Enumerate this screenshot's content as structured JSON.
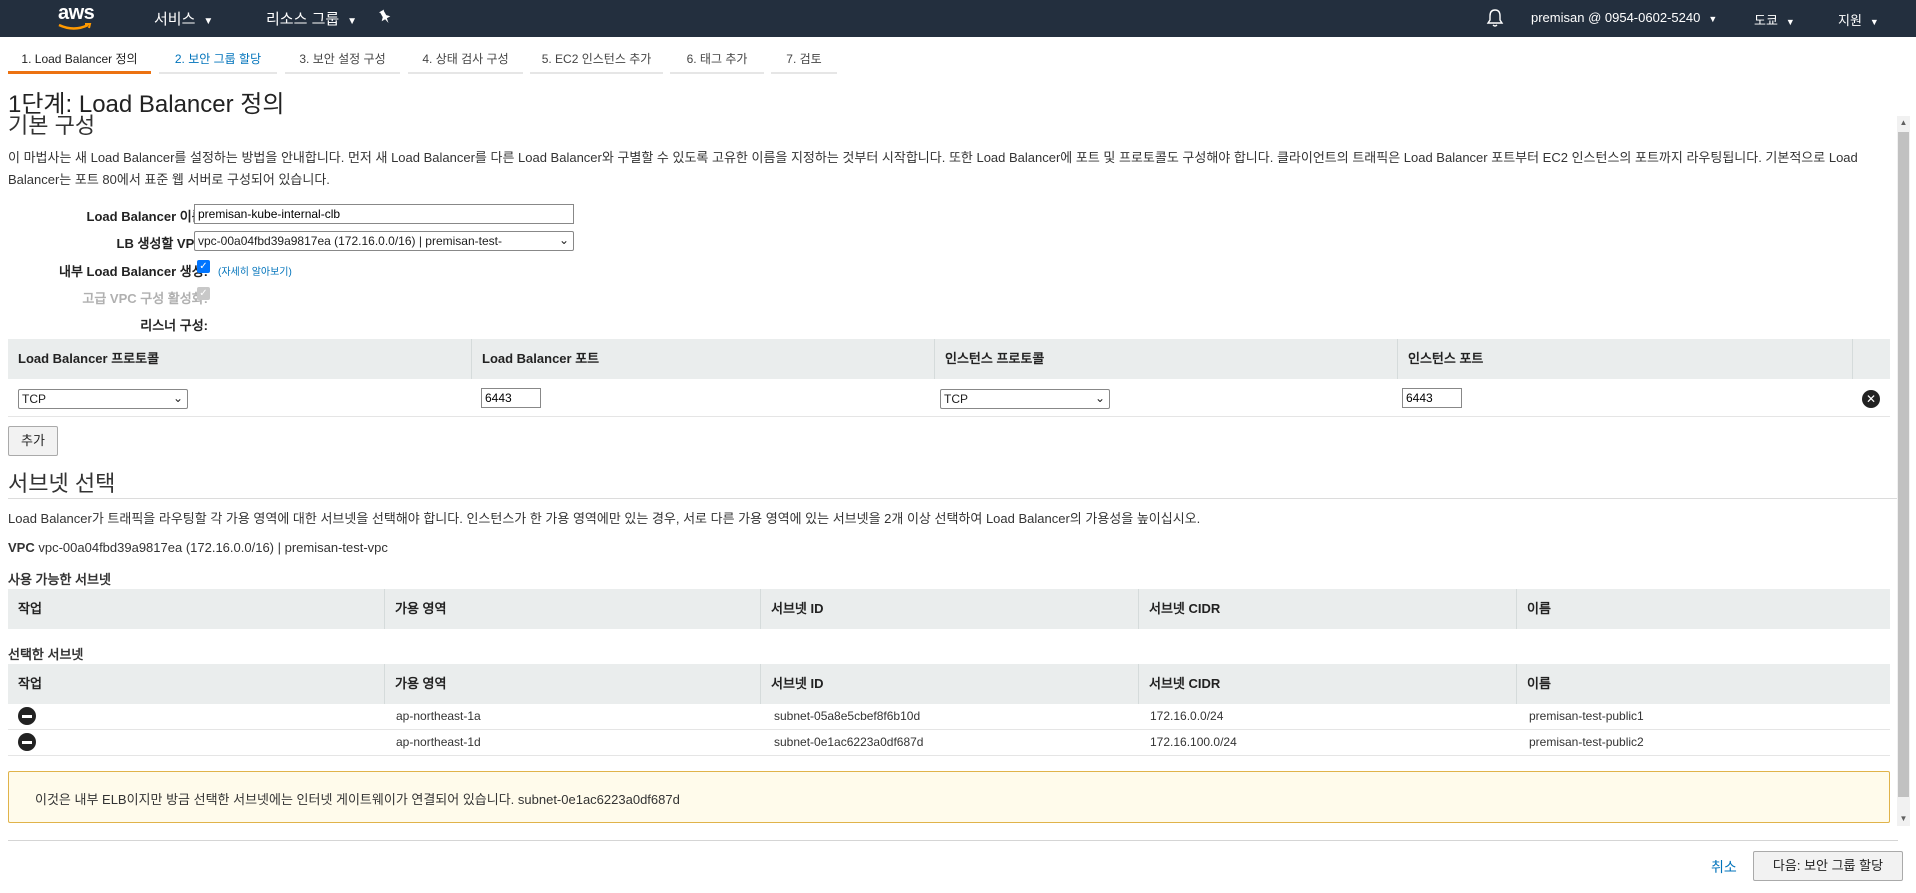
{
  "topnav": {
    "logo": "aws",
    "services": "서비스",
    "resource_groups": "리소스 그룹",
    "account": "premisan @ 0954-0602-5240",
    "region": "도쿄",
    "support": "지원",
    "colors": {
      "bg": "#232f3e",
      "accent": "#ec7211"
    }
  },
  "tabs": [
    {
      "label": "1. Load Balancer 정의"
    },
    {
      "label": "2. 보안 그룹 할당"
    },
    {
      "label": "3. 보안 설정 구성"
    },
    {
      "label": "4. 상태 검사 구성"
    },
    {
      "label": "5. EC2 인스턴스 추가"
    },
    {
      "label": "6. 태그 추가"
    },
    {
      "label": "7. 검토"
    }
  ],
  "page": {
    "title": "1단계: Load Balancer 정의",
    "subtitle": "기본 구성",
    "description": "이 마법사는 새 Load Balancer를 설정하는 방법을 안내합니다. 먼저 새 Load Balancer를 다른 Load Balancer와 구별할 수 있도록 고유한 이름을 지정하는 것부터 시작합니다. 또한 Load Balancer에 포트 및 프로토콜도 구성해야 합니다. 클라이언트의 트래픽은 Load Balancer 포트부터 EC2 인스턴스의 포트까지 라우팅됩니다. 기본적으로 Load Balancer는 포트 80에서 표준 웹 서버로 구성되어 있습니다."
  },
  "form": {
    "name_label": "Load Balancer 이름:",
    "name_value": "premisan-kube-internal-clb",
    "vpc_label": "LB 생성할 VPC:",
    "vpc_value": "vpc-00a04fbd39a9817ea (172.16.0.0/16) | premisan-test-",
    "internal_label": "내부 Load Balancer 생성:",
    "internal_checked": true,
    "learn_more": "(자세히 알아보기)",
    "advanced_label": "고급 VPC 구성 활성화:",
    "listener_label": "리스너 구성:"
  },
  "listeners": {
    "headers": [
      "Load Balancer 프로토콜",
      "Load Balancer 포트",
      "인스턴스 프로토콜",
      "인스턴스 포트"
    ],
    "rows": [
      {
        "lb_protocol": "TCP",
        "lb_port": "6443",
        "instance_protocol": "TCP",
        "instance_port": "6443"
      }
    ],
    "add_button": "추가"
  },
  "subnets": {
    "section_title": "서브넷 선택",
    "description": "Load Balancer가 트래픽을 라우팅할 각 가용 영역에 대한 서브넷을 선택해야 합니다. 인스턴스가 한 가용 영역에만 있는 경우, 서로 다른 가용 영역에 있는 서브넷을 2개 이상 선택하여 Load Balancer의 가용성을 높이십시오.",
    "vpc_label": "VPC",
    "vpc_value": "vpc-00a04fbd39a9817ea (172.16.0.0/16) | premisan-test-vpc",
    "available_title": "사용 가능한 서브넷",
    "selected_title": "선택한 서브넷",
    "headers": [
      "작업",
      "가용 영역",
      "서브넷 ID",
      "서브넷 CIDR",
      "이름"
    ],
    "selected_rows": [
      {
        "az": "ap-northeast-1a",
        "subnet_id": "subnet-05a8e5cbef8f6b10d",
        "cidr": "172.16.0.0/24",
        "name": "premisan-test-public1"
      },
      {
        "az": "ap-northeast-1d",
        "subnet_id": "subnet-0e1ac6223a0df687d",
        "cidr": "172.16.100.0/24",
        "name": "premisan-test-public2"
      }
    ]
  },
  "warning": "이것은 내부 ELB이지만 방금 선택한 서브넷에는 인터넷 게이트웨이가 연결되어 있습니다. subnet-0e1ac6223a0df687d",
  "footer": {
    "cancel": "취소",
    "next": "다음: 보안 그룹 할당"
  }
}
